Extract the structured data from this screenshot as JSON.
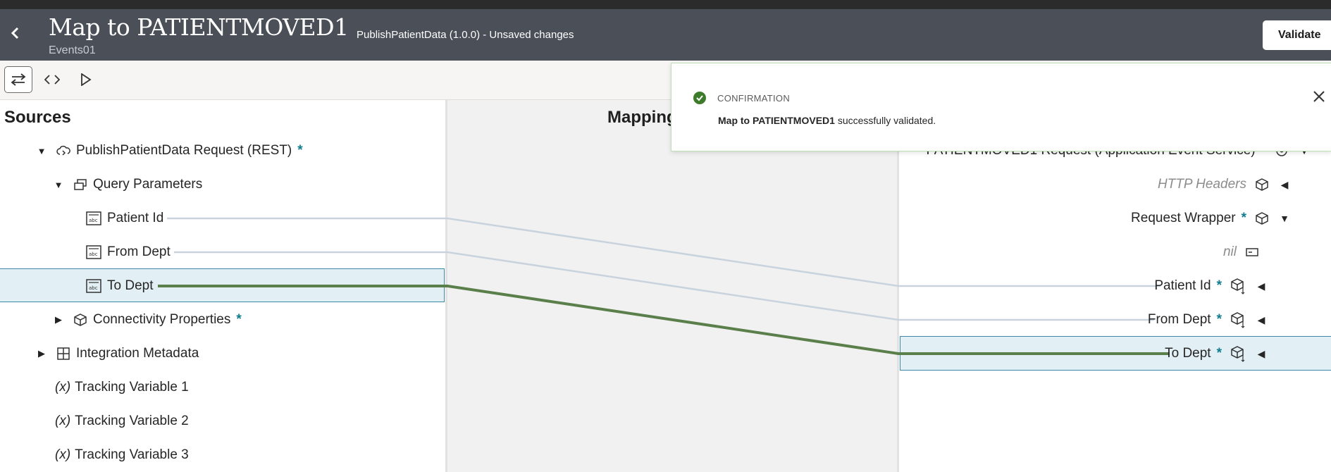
{
  "header": {
    "title": "Map to PATIENTMOVED1",
    "subtitle": "Events01",
    "integration": "PublishPatientData (1.0.0) - Unsaved changes",
    "validate_label": "Validate"
  },
  "toolbar": {
    "buttons": [
      {
        "icon": "swap-arrows-icon",
        "active": true
      },
      {
        "icon": "code-brackets-icon",
        "active": false
      },
      {
        "icon": "play-icon",
        "active": false
      }
    ]
  },
  "sources": {
    "title": "Sources",
    "root": {
      "label": "PublishPatientData Request (REST)",
      "required": "*"
    },
    "query": {
      "label": "Query Parameters"
    },
    "patient_id": {
      "label": "Patient Id"
    },
    "from_dept": {
      "label": "From Dept"
    },
    "to_dept": {
      "label": "To Dept"
    },
    "connectivity": {
      "label": "Connectivity Properties",
      "required": "*"
    },
    "integration_metadata": {
      "label": "Integration Metadata"
    },
    "tracking1": {
      "label": "Tracking Variable 1",
      "prefix": "(x)"
    },
    "tracking2": {
      "label": "Tracking Variable 2",
      "prefix": "(x)"
    },
    "tracking3": {
      "label": "Tracking Variable 3",
      "prefix": "(x)"
    }
  },
  "mapping": {
    "title": "Mapping"
  },
  "target": {
    "root": {
      "label": "PATIENTMOVED1 Request (Application Event Service)",
      "required": "*"
    },
    "http_headers": {
      "label": "HTTP Headers"
    },
    "request_wrapper": {
      "label": "Request Wrapper",
      "required": "*"
    },
    "nil": {
      "label": "nil"
    },
    "patient_id": {
      "label": "Patient Id",
      "required": "*"
    },
    "from_dept": {
      "label": "From Dept",
      "required": "*"
    },
    "to_dept": {
      "label": "To Dept",
      "required": "*"
    }
  },
  "toast": {
    "kind": "CONFIRMATION",
    "bold": "Map to PATIENTMOVED1",
    "message": " successfully validated."
  },
  "colors": {
    "header_bg": "#4a4f58",
    "active_mapping": "#5a7f4a",
    "inactive_mapping": "#c9d3de",
    "required": "#0f7c8c",
    "selected_bg": "#e2f0f6"
  }
}
